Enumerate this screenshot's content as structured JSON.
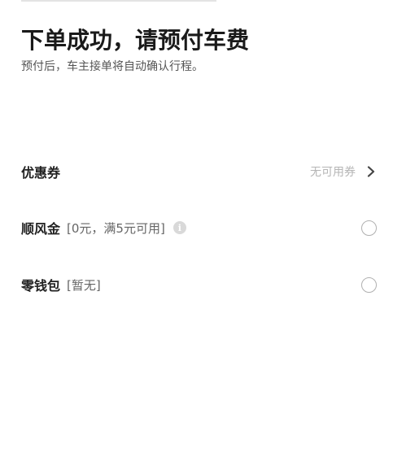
{
  "header": {
    "title": "下单成功，请预付车费",
    "subtitle": "预付后，车主接单将自动确认行程。"
  },
  "coupon": {
    "label": "优惠券",
    "value": "无可用券",
    "chevron_icon": "chevron-right-icon"
  },
  "shunfeng": {
    "label": "顺风金",
    "note": "[0元，满5元可用]",
    "info_icon": "info-icon",
    "info_glyph": "i",
    "selected": false
  },
  "wallet": {
    "label": "零钱包",
    "note": "[暂无]",
    "selected": false
  },
  "colors": {
    "text_primary": "#222222",
    "text_secondary": "#666666",
    "text_muted": "#b5b5b5",
    "radio_border": "#b0b0b0"
  }
}
